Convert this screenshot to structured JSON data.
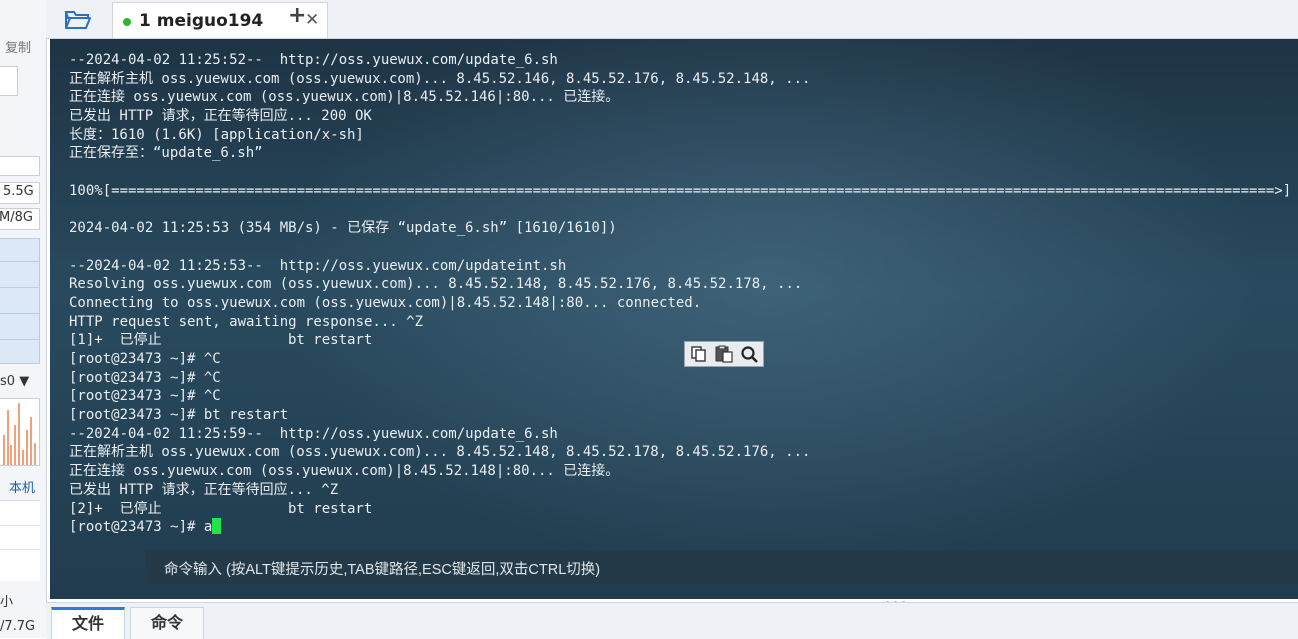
{
  "left_panel": {
    "copy_label": "复制",
    "disk_value": "5.5G",
    "mem_value": "M/8G",
    "dropdown_label": "s0",
    "local_label": "本机",
    "size_label": "小",
    "size_value": "/7.7G"
  },
  "tabs": {
    "session_tab_label": "1 meiguo194",
    "close_symbol": "✕",
    "new_tab_symbol": "+"
  },
  "terminal": {
    "lines": [
      "--2024-04-02 11:25:52--  http://oss.yuewux.com/update_6.sh",
      "正在解析主机 oss.yuewux.com (oss.yuewux.com)... 8.45.52.146, 8.45.52.176, 8.45.52.148, ...",
      "正在连接 oss.yuewux.com (oss.yuewux.com)|8.45.52.146|:80... 已连接。",
      "已发出 HTTP 请求，正在等待回应... 200 OK",
      "长度：1610 (1.6K) [application/x-sh]",
      "正在保存至：“update_6.sh”",
      "",
      "100%[==========================================================================================================================================>]",
      "",
      "2024-04-02 11:25:53 (354 MB/s) - 已保存 “update_6.sh” [1610/1610])",
      "",
      "--2024-04-02 11:25:53--  http://oss.yuewux.com/updateint.sh",
      "Resolving oss.yuewux.com (oss.yuewux.com)... 8.45.52.148, 8.45.52.176, 8.45.52.178, ...",
      "Connecting to oss.yuewux.com (oss.yuewux.com)|8.45.52.148|:80... connected.",
      "HTTP request sent, awaiting response... ^Z",
      "[1]+  已停止               bt restart",
      "[root@23473 ~]# ^C",
      "[root@23473 ~]# ^C",
      "[root@23473 ~]# ^C",
      "[root@23473 ~]# bt restart",
      "--2024-04-02 11:25:59--  http://oss.yuewux.com/update_6.sh",
      "正在解析主机 oss.yuewux.com (oss.yuewux.com)... 8.45.52.148, 8.45.52.178, 8.45.52.176, ...",
      "正在连接 oss.yuewux.com (oss.yuewux.com)|8.45.52.148|:80... 已连接。",
      "已发出 HTTP 请求，正在等待回应... ^Z",
      "[2]+  已停止               bt restart"
    ],
    "prompt_line": "[root@23473 ~]# a",
    "cursor_color": "#21e34a",
    "text_color": "#e8eef2",
    "background_color": "#294a5e"
  },
  "command_bar": {
    "hint": "命令输入 (按ALT键提示历史,TAB键路径,ESC键返回,双击CTRL切换)"
  },
  "mini_toolbar": {
    "copy_icon": "copy-icon",
    "paste_icon": "paste-icon",
    "search_icon": "search-icon"
  },
  "bottom_tabs": {
    "file_label": "文件",
    "command_label": "命令"
  },
  "colors": {
    "active_tab_accent": "#2a7ed8",
    "session_status": "#2db52d"
  }
}
